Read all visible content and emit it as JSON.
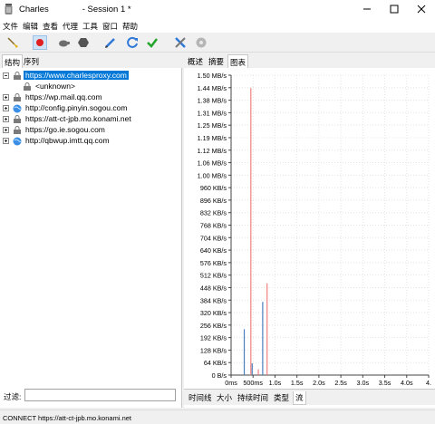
{
  "window": {
    "app_name": "Charles",
    "session_title": "- Session 1 *"
  },
  "menu": [
    {
      "label": "文件"
    },
    {
      "label": "编辑"
    },
    {
      "label": "查看"
    },
    {
      "label": "代理"
    },
    {
      "label": "工具"
    },
    {
      "label": "窗口"
    },
    {
      "label": "帮助"
    }
  ],
  "toolbar": [
    {
      "name": "broom-icon",
      "color": "#d8a400"
    },
    {
      "name": "record-icon",
      "color": "#e02020"
    },
    {
      "name": "throttle-turtle-icon",
      "color": "#666666"
    },
    {
      "name": "breakpoint-hexagon-icon",
      "color": "#555555"
    },
    {
      "name": "pen-compose-icon",
      "color": "#2f79d8"
    },
    {
      "name": "refresh-icon",
      "color": "#2f79d8"
    },
    {
      "name": "validate-check-icon",
      "color": "#22a52a"
    },
    {
      "name": "tools-icon",
      "color": "#2f79d8"
    },
    {
      "name": "settings-gear-icon",
      "color": "#aaaaaa"
    }
  ],
  "left_panel": {
    "tabs": [
      {
        "label": "结构"
      },
      {
        "label": "序列"
      }
    ],
    "tree": [
      {
        "label": "https://www.charlesproxy.com",
        "expanded": true,
        "selected": true,
        "icon": "lock-icon"
      },
      {
        "label": "<unknown>",
        "child": true,
        "icon": "lock-icon"
      },
      {
        "label": "https://wp.mail.qq.com",
        "icon": "lock-icon"
      },
      {
        "label": "http://config.pinyin.sogou.com",
        "icon": "globe-icon"
      },
      {
        "label": "https://att-ct-jpb.mo.konami.net",
        "icon": "lock-icon"
      },
      {
        "label": "https://go.ie.sogou.com",
        "icon": "lock-icon"
      },
      {
        "label": "http://qbwup.imtt.qq.com",
        "icon": "globe-icon"
      }
    ],
    "filter_label": "过滤:",
    "filter_value": ""
  },
  "right_panel": {
    "top_tabs": [
      {
        "label": "概述"
      },
      {
        "label": "摘要"
      },
      {
        "label": "图表"
      }
    ],
    "selected_top_tab": "图表",
    "bottom_tabs": [
      {
        "label": "时间线"
      },
      {
        "label": "大小"
      },
      {
        "label": "持续时间"
      },
      {
        "label": "类型"
      },
      {
        "label": "流"
      }
    ],
    "selected_bottom_tab": "流"
  },
  "chart_data": {
    "type": "bar",
    "title": "",
    "xlabel": "",
    "ylabel": "",
    "y_ticks": [
      "1.50 MB/s",
      "1.44 MB/s",
      "1.38 MB/s",
      "1.31 MB/s",
      "1.25 MB/s",
      "1.19 MB/s",
      "1.12 MB/s",
      "1.06 MB/s",
      "1.00 MB/s",
      "960 KB/s",
      "896 KB/s",
      "832 KB/s",
      "768 KB/s",
      "704 KB/s",
      "640 KB/s",
      "576 KB/s",
      "512 KB/s",
      "448 KB/s",
      "384 KB/s",
      "320 KB/s",
      "256 KB/s",
      "192 KB/s",
      "128 KB/s",
      "64 KB/s",
      "0 B/s"
    ],
    "x_ticks": [
      "0ms",
      "500ms",
      "1.0s",
      "1.5s",
      "2.0s",
      "2.5s",
      "3.0s",
      "3.5s",
      "4.0s",
      "4."
    ],
    "ylim": [
      0,
      1536
    ],
    "xlim": [
      0,
      4.5
    ],
    "grid": true,
    "series": [
      {
        "color": "#f08080",
        "x": [
          0.45,
          0.62,
          0.82
        ],
        "values": [
          1470,
          30,
          470
        ]
      },
      {
        "color": "#4a7fc0",
        "x": [
          0.3,
          0.48,
          0.72
        ],
        "values": [
          235,
          60,
          375
        ]
      }
    ]
  },
  "status_bar": {
    "text": "CONNECT https://att-ct-jpb.mo.konami.net"
  }
}
